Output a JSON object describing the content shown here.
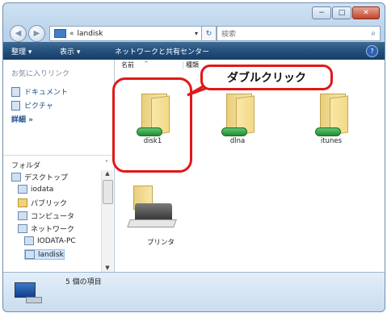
{
  "window": {
    "controls": {
      "minimize": "−",
      "maximize": "□",
      "close": "✕"
    }
  },
  "address_bar": {
    "prefix": "«",
    "path": "landisk",
    "dropdown": "▾",
    "refresh": "↻"
  },
  "search": {
    "placeholder": "検索",
    "icon": "search-icon"
  },
  "toolbar": {
    "organize": "整理 ▾",
    "views": "表示 ▾",
    "network_center": "ネットワークと共有センター",
    "help": "?"
  },
  "left_pane": {
    "favorites_title": "お気に入りリンク",
    "favorites": [
      {
        "label": "ドキュメント",
        "icon": "document-icon"
      },
      {
        "label": "ピクチャ",
        "icon": "picture-icon"
      },
      {
        "label": "詳細 »",
        "icon": ""
      }
    ],
    "folders_title": "フォルダ",
    "tree": [
      {
        "label": "デスクトップ",
        "icon": "desktop-icon"
      },
      {
        "label": "iodata",
        "icon": "user-folder-icon"
      },
      {
        "label": "パブリック",
        "icon": "folder-icon"
      },
      {
        "label": "コンピュータ",
        "icon": "computer-icon"
      },
      {
        "label": "ネットワーク",
        "icon": "network-icon"
      },
      {
        "label": "IODATA-PC",
        "icon": "computer-icon"
      },
      {
        "label": "landisk",
        "icon": "server-icon"
      }
    ]
  },
  "columns": {
    "name": "名前",
    "type": "種類"
  },
  "items": [
    {
      "label": "disk1",
      "icon": "network-share-folder-icon"
    },
    {
      "label": "dlna",
      "icon": "network-share-folder-icon"
    },
    {
      "label": "itunes",
      "icon": "network-share-folder-icon"
    },
    {
      "label": "プリンタ",
      "icon": "printer-icon"
    }
  ],
  "annotation": {
    "callout": "ダブルクリック",
    "color": "#e01818"
  },
  "details": {
    "count": "5 個の項目"
  },
  "colors": {
    "toolbar": "#24507c",
    "accent": "#1a4e8b",
    "highlight": "#e01818"
  }
}
